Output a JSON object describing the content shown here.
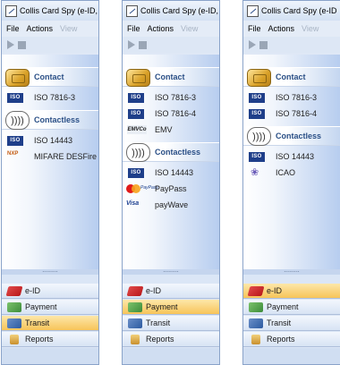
{
  "panels": [
    {
      "title": "Collis Card Spy (e-ID, e-",
      "menu": [
        "File",
        "Actions",
        "View"
      ],
      "groups": [
        {
          "label": "Contact",
          "icon": "contact-chip-icon"
        },
        {
          "label": "Contactless",
          "icon": "contactless-icon"
        }
      ],
      "contact_items": [
        {
          "icon": "iso-icon",
          "badge": "ISO",
          "label": "ISO 7816-3"
        }
      ],
      "contactless_items": [
        {
          "icon": "iso-icon",
          "badge": "ISO",
          "label": "ISO 14443"
        },
        {
          "icon": "mifare-icon",
          "badge": "NXP",
          "label": "MIFARE DESFire"
        }
      ],
      "nav": [
        "e-ID",
        "Payment",
        "Transit",
        "Reports"
      ],
      "selected_nav": "Transit"
    },
    {
      "title": "Collis Card Spy (e-ID, e-",
      "menu": [
        "File",
        "Actions",
        "View"
      ],
      "groups": [
        {
          "label": "Contact",
          "icon": "contact-chip-icon"
        },
        {
          "label": "Contactless",
          "icon": "contactless-icon"
        }
      ],
      "contact_items": [
        {
          "icon": "iso-icon",
          "badge": "ISO",
          "label": "ISO 7816-3"
        },
        {
          "icon": "iso-icon",
          "badge": "ISO",
          "label": "ISO 7816-4"
        },
        {
          "icon": "emv-icon",
          "badge": "EMVCo",
          "label": "EMV"
        }
      ],
      "contactless_items": [
        {
          "icon": "iso-icon",
          "badge": "ISO",
          "label": "ISO 14443"
        },
        {
          "icon": "mastercard-paypass-icon",
          "badge": "PayPass",
          "label": "PayPass"
        },
        {
          "icon": "visa-paywave-icon",
          "badge": "Visa",
          "label": "payWave"
        }
      ],
      "nav": [
        "e-ID",
        "Payment",
        "Transit",
        "Reports"
      ],
      "selected_nav": "Payment"
    },
    {
      "title": "Collis Card Spy (e-ID",
      "menu": [
        "File",
        "Actions",
        "View"
      ],
      "groups": [
        {
          "label": "Contact",
          "icon": "contact-chip-icon"
        },
        {
          "label": "Contactless",
          "icon": "contactless-icon"
        }
      ],
      "contact_items": [
        {
          "icon": "iso-icon",
          "badge": "ISO",
          "label": "ISO 7816-3"
        },
        {
          "icon": "iso-icon",
          "badge": "ISO",
          "label": "ISO 7816-4"
        }
      ],
      "contactless_items": [
        {
          "icon": "iso-icon",
          "badge": "ISO",
          "label": "ISO 14443"
        },
        {
          "icon": "icao-icon",
          "badge": "",
          "label": "ICAO"
        }
      ],
      "nav": [
        "e-ID",
        "Payment",
        "Transit",
        "Reports"
      ],
      "selected_nav": "e-ID"
    }
  ],
  "colors": {
    "selected_nav": "#f7c45a",
    "group_label": "#2a4f86",
    "iso_badge": "#1f3f8a"
  }
}
